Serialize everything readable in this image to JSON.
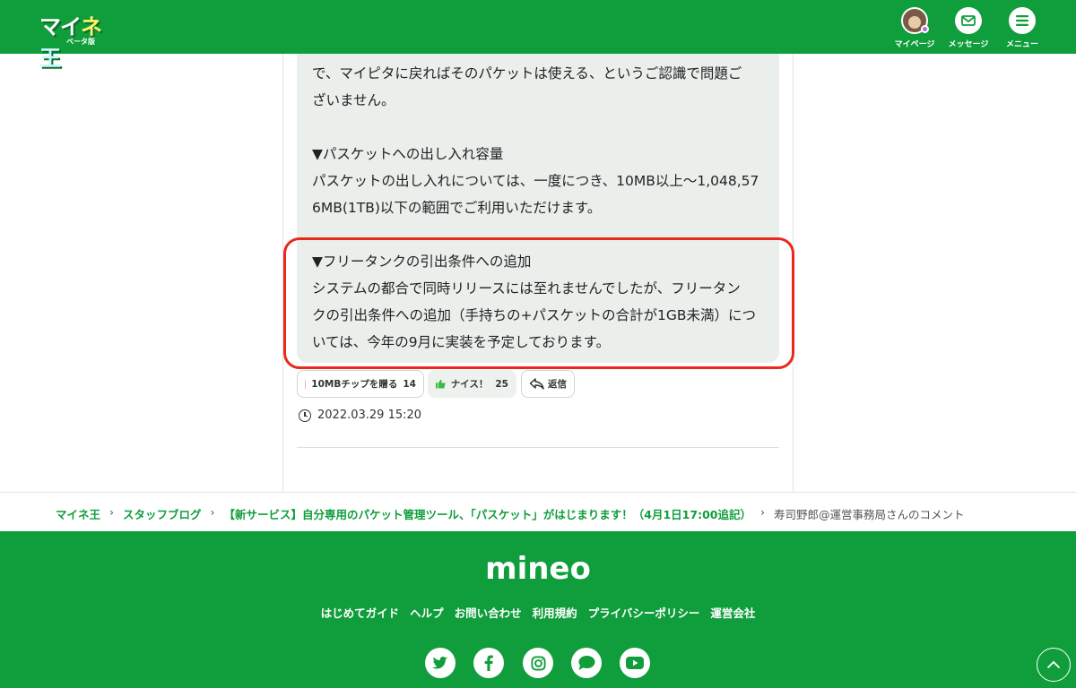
{
  "header": {
    "logo_text_a": "マイ",
    "logo_text_b": "ネ",
    "logo_text_c": "王",
    "logo_sub": "ベータ版",
    "nav": [
      {
        "label": "マイページ",
        "icon": "avatar-icon"
      },
      {
        "label": "メッセージ",
        "icon": "mail-icon"
      },
      {
        "label": "メニュー",
        "icon": "menu-icon"
      }
    ]
  },
  "comment": {
    "lines": [
      "で、マイピタに戻ればそのパケットは使える、というご認識で問題ご",
      "ざいません。",
      "▼パスケットへの出し入れ容量",
      "パスケットの出し入れについては、一度につき、10MB以上〜1,048,57",
      "6MB(1TB)以下の範囲でご利用いただけます。",
      "▼フリータンクの引出条件への追加",
      "システムの都合で同時リリースには至れませんでしたが、フリータン",
      "クの引出条件への追加（手持ちの+パスケットの合計が1GB未満）につ",
      "いては、今年の9月に実装を予定しております。"
    ],
    "actions": {
      "tip_label": "10MBチップを贈る",
      "tip_count": "14",
      "nice_label": "ナイス！",
      "nice_count": "25",
      "reply_label": "返信"
    },
    "date": "2022.03.29 15:20"
  },
  "breadcrumb": {
    "items": [
      "マイネ王",
      "スタッフブログ",
      "【新サービス】自分専用のパケット管理ツール、「パスケット」がはじまります！（4月1日17:00追記）"
    ],
    "current": "寿司野郎@運営事務局さんのコメント",
    "separator": "›"
  },
  "footer": {
    "logo": "mineo",
    "links": [
      "はじめてガイド",
      "ヘルプ",
      "お問い合わせ",
      "利用規約",
      "プライバシーポリシー",
      "運営会社"
    ],
    "social": [
      "twitter-icon",
      "facebook-icon",
      "instagram-icon",
      "chat-icon",
      "youtube-icon"
    ]
  },
  "colors": {
    "brand_green": "#0f9e3b",
    "highlight_red": "#e8291b",
    "bubble_bg": "#ebefec"
  }
}
